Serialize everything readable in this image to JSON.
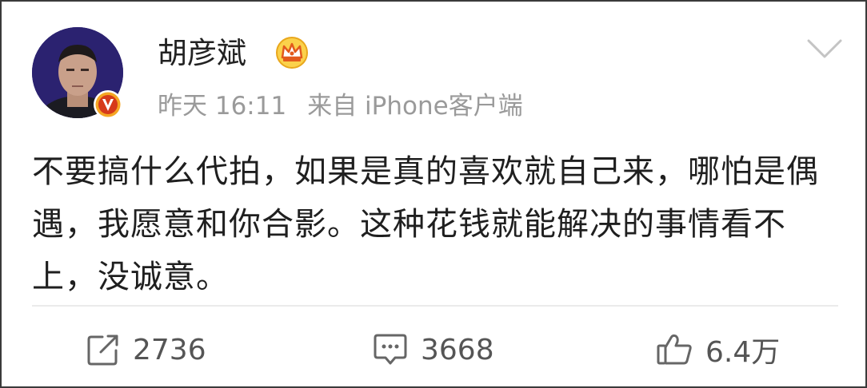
{
  "author": {
    "name": "胡彦斌",
    "avatar_icon": "user-avatar",
    "verified_icon": "verified-v-badge-icon",
    "member_icon": "crown-icon"
  },
  "meta": {
    "time": "昨天 16:11",
    "source": "来自 iPhone客户端"
  },
  "post": {
    "text": "不要搞什么代拍，如果是真的喜欢就自己来，哪怕是偶遇，我愿意和你合影。这种花钱就能解决的事情看不上，没诚意。"
  },
  "actions": {
    "repost": {
      "icon": "share-arrow-icon",
      "count": "2736"
    },
    "comment": {
      "icon": "comment-bubble-icon",
      "count": "3668"
    },
    "like": {
      "icon": "thumbs-up-icon",
      "count": "6.4万"
    }
  },
  "colors": {
    "text": "#222222",
    "meta": "#9a9a9a",
    "divider": "#ebebeb",
    "badge_orange": "#f5a623",
    "badge_red": "#d63a1a"
  }
}
